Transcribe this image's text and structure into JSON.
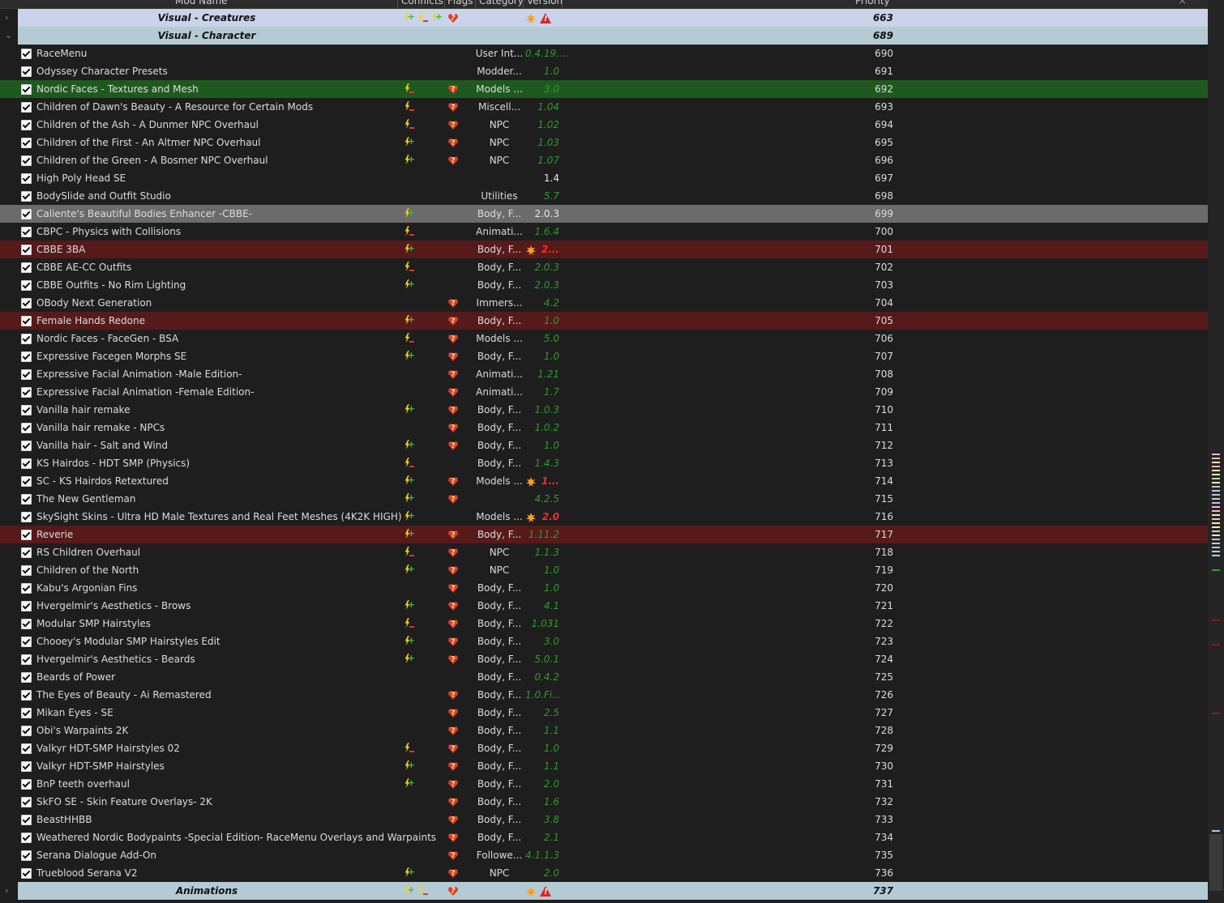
{
  "header": {
    "cols": [
      "Mod Name",
      "Conflicts",
      "Flags",
      "Category",
      "Version",
      "Priority"
    ],
    "close": "×"
  },
  "rows": [
    {
      "kind": "sep",
      "name": "Visual - Creatures",
      "priority": "663",
      "expander": "›",
      "conf": [
        "plus",
        "minus",
        "plus"
      ],
      "flag": true,
      "vicons": [
        "sun",
        "warn"
      ]
    },
    {
      "kind": "sep",
      "name": "Visual - Character",
      "priority": "689",
      "expander": "⌄",
      "alt": true
    },
    {
      "name": "RaceMenu",
      "cat": "User Int...",
      "ver": "0.4.19....",
      "priority": "690"
    },
    {
      "name": "Odyssey Character Presets",
      "cat": "Modder...",
      "ver": "1.0",
      "priority": "691"
    },
    {
      "name": "Nordic Faces - Textures and Mesh",
      "conf": [
        "minus"
      ],
      "flag": true,
      "cat": "Models ...",
      "ver": "3.0",
      "priority": "692",
      "hl": "green"
    },
    {
      "name": "Children of Dawn's Beauty - A Resource for Certain Mods",
      "conf": [
        "minus"
      ],
      "flag": true,
      "cat": "Miscell...",
      "ver": "1.04",
      "priority": "693"
    },
    {
      "name": "Children of the Ash - A Dunmer NPC Overhaul",
      "conf": [
        "minus"
      ],
      "flag": true,
      "cat": "NPC",
      "ver": "1.02",
      "priority": "694"
    },
    {
      "name": "Children of the First - An Altmer NPC Overhaul",
      "conf": [
        "plus"
      ],
      "flag": true,
      "cat": "NPC",
      "ver": "1.03",
      "priority": "695"
    },
    {
      "name": "Children of the Green - A Bosmer NPC Overhaul",
      "conf": [
        "plus"
      ],
      "flag": true,
      "cat": "NPC",
      "ver": "1.07",
      "priority": "696"
    },
    {
      "name": "High Poly Head SE",
      "ver": "1.4",
      "vc": "white",
      "priority": "697"
    },
    {
      "name": "BodySlide and Outfit Studio",
      "cat": "Utilities",
      "ver": "5.7",
      "priority": "698"
    },
    {
      "name": "Caliente's Beautiful Bodies Enhancer -CBBE-",
      "conf": [
        "plus"
      ],
      "cat": "Body, F...",
      "ver": "2.0.3",
      "vc": "white",
      "priority": "699",
      "hl": "gray"
    },
    {
      "name": "CBPC - Physics with Collisions",
      "conf": [
        "minus"
      ],
      "cat": "Animati...",
      "ver": "1.6.4",
      "priority": "700"
    },
    {
      "name": "CBBE 3BA",
      "conf": [
        "plus"
      ],
      "cat": "Body, F...",
      "ver": "2...",
      "vc": "red",
      "sun": true,
      "priority": "701",
      "hl": "red"
    },
    {
      "name": "CBBE AE-CC Outfits",
      "conf": [
        "minus"
      ],
      "cat": "Body, F...",
      "ver": "2.0.3",
      "priority": "702"
    },
    {
      "name": "CBBE Outfits - No Rim Lighting",
      "conf": [
        "plus"
      ],
      "cat": "Body, F...",
      "ver": "2.0.3",
      "priority": "703"
    },
    {
      "name": "OBody Next Generation",
      "flag": true,
      "cat": "Immers...",
      "ver": "4.2",
      "priority": "704"
    },
    {
      "name": "Female Hands Redone",
      "conf": [
        "plus"
      ],
      "flag": true,
      "cat": "Body, F...",
      "ver": "1.0",
      "priority": "705",
      "hl": "red"
    },
    {
      "name": "Nordic Faces - FaceGen - BSA",
      "conf": [
        "minus"
      ],
      "flag": true,
      "cat": "Models ...",
      "ver": "5.0",
      "priority": "706"
    },
    {
      "name": "Expressive Facegen Morphs SE",
      "conf": [
        "plus"
      ],
      "flag": true,
      "cat": "Body, F...",
      "ver": "1.0",
      "priority": "707"
    },
    {
      "name": "Expressive Facial Animation -Male Edition-",
      "flag": true,
      "cat": "Animati...",
      "ver": "1.21",
      "priority": "708"
    },
    {
      "name": "Expressive Facial Animation -Female Edition-",
      "flag": true,
      "cat": "Animati...",
      "ver": "1.7",
      "priority": "709"
    },
    {
      "name": "Vanilla hair remake",
      "conf": [
        "plus"
      ],
      "flag": true,
      "cat": "Body, F...",
      "ver": "1.0.3",
      "priority": "710"
    },
    {
      "name": "Vanilla hair remake - NPCs",
      "flag": true,
      "cat": "Body, F...",
      "ver": "1.0.2",
      "priority": "711"
    },
    {
      "name": "Vanilla hair - Salt and Wind",
      "conf": [
        "plus"
      ],
      "flag": true,
      "cat": "Body, F...",
      "ver": "1.0",
      "priority": "712"
    },
    {
      "name": "KS Hairdos - HDT SMP (Physics)",
      "conf": [
        "minus"
      ],
      "cat": "Body, F...",
      "ver": "1.4.3",
      "priority": "713"
    },
    {
      "name": "SC - KS Hairdos Retextured",
      "conf": [
        "plus"
      ],
      "flag": true,
      "cat": "Models ...",
      "ver": "1...",
      "vc": "red",
      "sun": true,
      "priority": "714"
    },
    {
      "name": "The New Gentleman",
      "conf": [
        "plus"
      ],
      "flag": true,
      "ver": "4.2.5",
      "priority": "715"
    },
    {
      "name": "SkySight Skins - Ultra HD Male Textures and Real Feet Meshes (4K2K HIGH)",
      "conf": [
        "plus"
      ],
      "cat": "Models ...",
      "ver": "2.0",
      "vc": "red",
      "sun": true,
      "priority": "716"
    },
    {
      "name": "Reverie",
      "conf": [
        "plus"
      ],
      "flag": true,
      "cat": "Body, F...",
      "ver": "1.11.2",
      "priority": "717",
      "hl": "red"
    },
    {
      "name": "RS Children Overhaul",
      "conf": [
        "minus"
      ],
      "flag": true,
      "cat": "NPC",
      "ver": "1.1.3",
      "priority": "718"
    },
    {
      "name": "Children of the North",
      "conf": [
        "plus"
      ],
      "flag": true,
      "cat": "NPC",
      "ver": "1.0",
      "priority": "719"
    },
    {
      "name": "Kabu's Argonian Fins",
      "flag": true,
      "cat": "Body, F...",
      "ver": "1.0",
      "priority": "720"
    },
    {
      "name": "Hvergelmir's Aesthetics - Brows",
      "conf": [
        "plus"
      ],
      "flag": true,
      "cat": "Body, F...",
      "ver": "4.1",
      "priority": "721"
    },
    {
      "name": "Modular SMP Hairstyles",
      "conf": [
        "minus"
      ],
      "flag": true,
      "cat": "Body, F...",
      "ver": "1.031",
      "priority": "722"
    },
    {
      "name": "Chooey's Modular SMP Hairstyles Edit",
      "conf": [
        "plus"
      ],
      "flag": true,
      "cat": "Body, F...",
      "ver": "3.0",
      "priority": "723"
    },
    {
      "name": "Hvergelmir's Aesthetics - Beards",
      "conf": [
        "plus"
      ],
      "flag": true,
      "cat": "Body, F...",
      "ver": "5.0.1",
      "priority": "724"
    },
    {
      "name": "Beards of Power",
      "cat": "Body, F...",
      "ver": "0.4.2",
      "priority": "725"
    },
    {
      "name": "The Eyes of Beauty - Ai Remastered",
      "flag": true,
      "cat": "Body, F...",
      "ver": "1.0.Fi...",
      "priority": "726"
    },
    {
      "name": "Mikan Eyes - SE",
      "flag": true,
      "cat": "Body, F...",
      "ver": "2.5",
      "priority": "727"
    },
    {
      "name": "Obi's Warpaints 2K",
      "flag": true,
      "cat": "Body, F...",
      "ver": "1.1",
      "priority": "728"
    },
    {
      "name": "Valkyr HDT-SMP Hairstyles 02",
      "conf": [
        "minus"
      ],
      "flag": true,
      "cat": "Body, F...",
      "ver": "1.0",
      "priority": "729"
    },
    {
      "name": "Valkyr HDT-SMP Hairstyles",
      "conf": [
        "plus"
      ],
      "flag": true,
      "cat": "Body, F...",
      "ver": "1.1",
      "priority": "730"
    },
    {
      "name": "BnP teeth overhaul",
      "conf": [
        "plus"
      ],
      "flag": true,
      "cat": "Body, F...",
      "ver": "2.0",
      "priority": "731"
    },
    {
      "name": "SkFO SE - Skin Feature Overlays- 2K",
      "flag": true,
      "cat": "Body, F...",
      "ver": "1.6",
      "priority": "732"
    },
    {
      "name": "BeastHHBB",
      "flag": true,
      "cat": "Body, F...",
      "ver": "3.8",
      "priority": "733"
    },
    {
      "name": "Weathered Nordic Bodypaints -Special Edition- RaceMenu Overlays and Warpaints",
      "flag": true,
      "cat": "Body, F...",
      "ver": "2.1",
      "priority": "734"
    },
    {
      "name": "Serana Dialogue Add-On",
      "flag": true,
      "cat": "Followe...",
      "ver": "4.1.1.3",
      "priority": "735"
    },
    {
      "name": "Trueblood Serana V2",
      "conf": [
        "plus"
      ],
      "flag": true,
      "cat": "NPC",
      "ver": "2.0",
      "priority": "736"
    },
    {
      "kind": "sep",
      "name": "Animations",
      "priority": "737",
      "expander": "›",
      "alt": true,
      "conf": [
        "plus",
        "minus"
      ],
      "flag": true,
      "vicons": [
        "sun",
        "warn"
      ]
    }
  ],
  "colors": {
    "separator_a": "#c9d3ea",
    "separator_b": "#b4cbd4",
    "highlight_green": "#1e5a1e",
    "highlight_red": "#571a1a",
    "highlight_gray": "#6b6b6b",
    "version_green": "#2e9a2e",
    "version_red": "#ff2a2a"
  }
}
